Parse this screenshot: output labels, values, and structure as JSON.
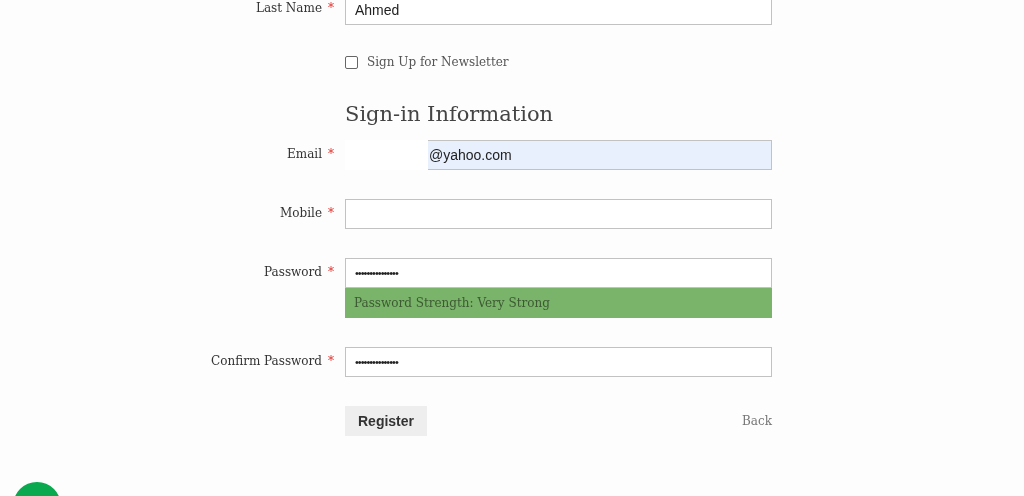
{
  "fields_top": [
    {
      "label": "Last Name",
      "required_mark": "*",
      "value": "Ahmed"
    }
  ],
  "newsletter": {
    "label": "Sign Up for Newsletter",
    "checked": false
  },
  "section_title": "Sign-in Information",
  "fields": [
    {
      "label": "Email",
      "required_mark": "*",
      "kind": "email",
      "value": "@yahoo.com",
      "autofilled": true,
      "redacted": true
    },
    {
      "label": "Mobile",
      "required_mark": "*",
      "kind": "tel",
      "autofilled": false
    },
    {
      "label": "Password",
      "required_mark": "*",
      "kind": "password",
      "value": "•••••••••••••••",
      "autofilled": false,
      "strength": "Password Strength: Very Strong"
    },
    {
      "label": "Confirm Password",
      "required_mark": "*",
      "kind": "password",
      "value": "•••••••••••••••",
      "autofilled": false
    }
  ],
  "buttons": {
    "register": "Register",
    "back": "Back"
  }
}
